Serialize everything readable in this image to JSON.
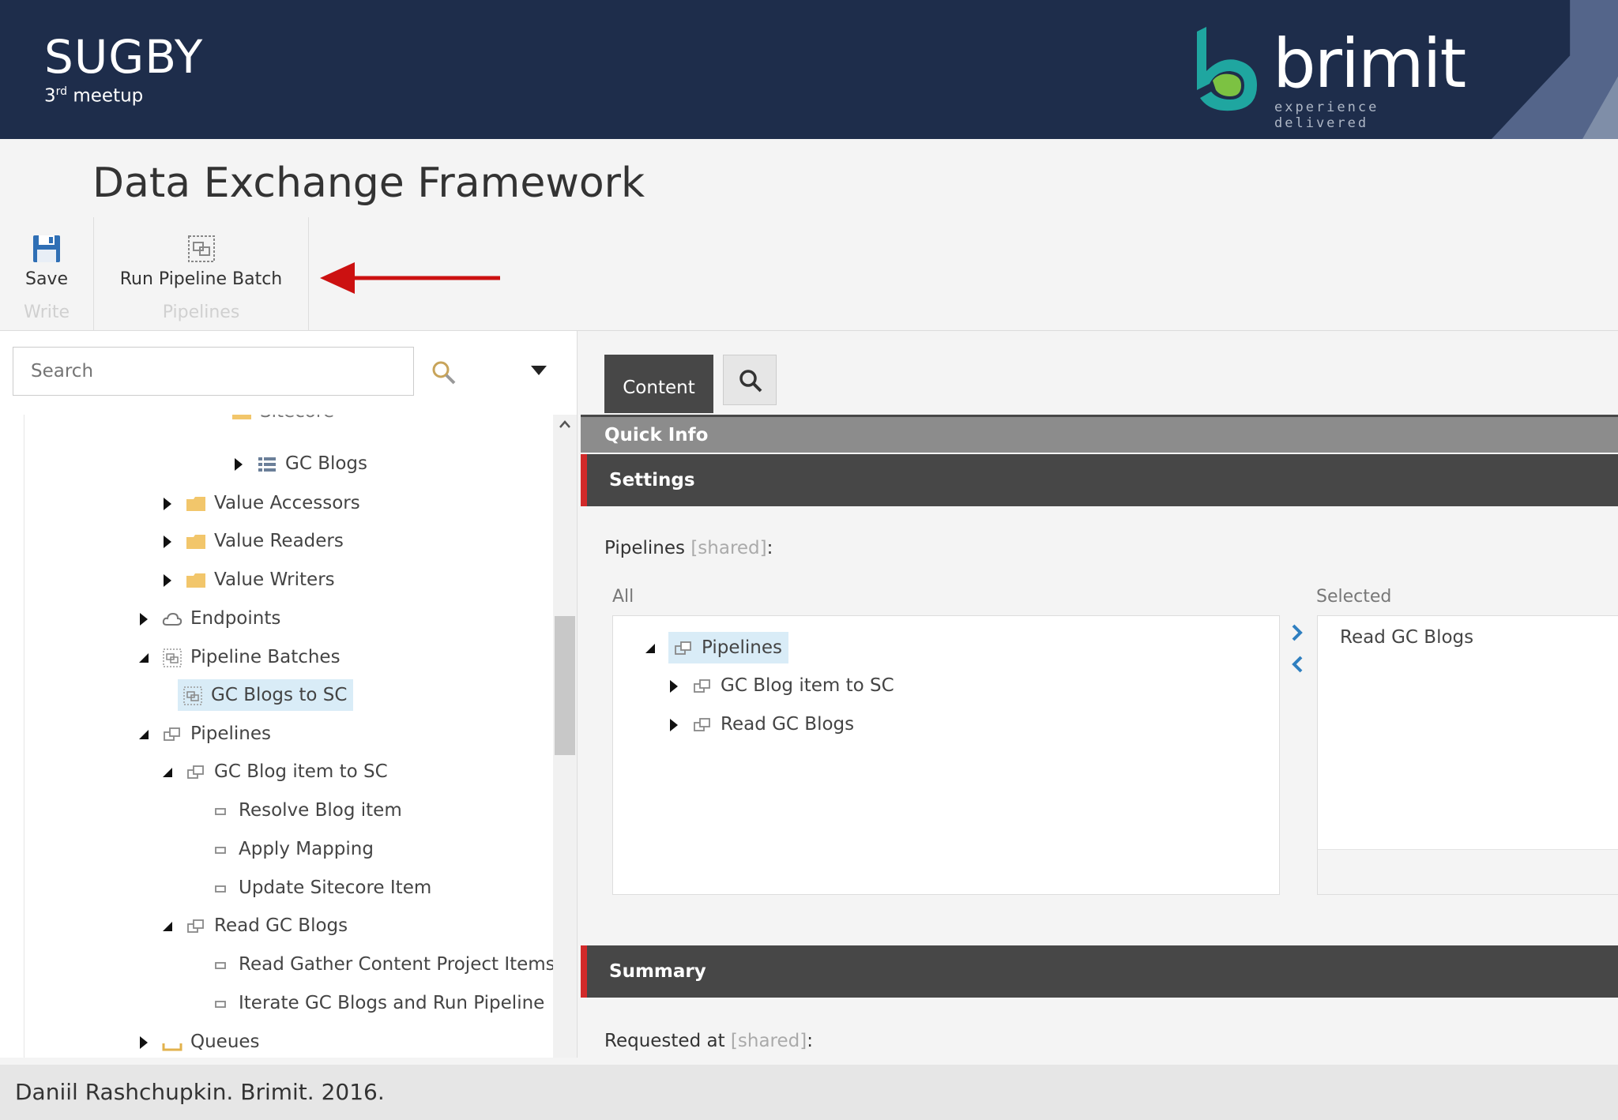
{
  "header": {
    "title": "SUGBY",
    "subtitle_number": "3",
    "subtitle_suffix": "rd",
    "subtitle_text": " meetup",
    "logo_word": "brimit",
    "logo_tagline": "experience delivered"
  },
  "slide": {
    "heading": "Data Exchange Framework"
  },
  "ribbon": {
    "save_label": "Save",
    "write_group": "Write",
    "run_label": "Run Pipeline Batch",
    "pipelines_group": "Pipelines"
  },
  "search": {
    "placeholder": "Search"
  },
  "tree": {
    "partial_top": "Sitecore",
    "gc_blogs": "GC Blogs",
    "value_accessors": "Value Accessors",
    "value_readers": "Value Readers",
    "value_writers": "Value Writers",
    "endpoints": "Endpoints",
    "pipeline_batches": "Pipeline Batches",
    "gc_blogs_to_sc": "GC Blogs to SC",
    "pipelines": "Pipelines",
    "gc_blog_item_to_sc": "GC Blog item to SC",
    "resolve_blog_item": "Resolve Blog item",
    "apply_mapping": "Apply Mapping",
    "update_sitecore_item": "Update Sitecore Item",
    "read_gc_blogs": "Read GC Blogs",
    "read_gather_content": "Read Gather Content Project Items Pip",
    "iterate_gc_blogs": "Iterate GC Blogs and Run Pipeline",
    "queues": "Queues"
  },
  "content": {
    "tab_label": "Content",
    "quick_info": "Quick Info",
    "settings": "Settings",
    "pipelines_field": "Pipelines",
    "shared_tag": "[shared]",
    "colon": ":",
    "all_label": "All",
    "selected_label": "Selected",
    "all_tree": {
      "root": "Pipelines",
      "child1": "GC Blog item to SC",
      "child2": "Read GC Blogs"
    },
    "selected_items": [
      "Read GC Blogs"
    ],
    "summary": "Summary",
    "requested_at_field": "Requested at"
  },
  "footer": {
    "text": "Daniil Rashchupkin. Brimit. 2016."
  },
  "colors": {
    "header_bg": "#1e2d4b",
    "accent_red": "#d12a2a",
    "section_bg": "#474747",
    "selection_bg": "#d9ecf7",
    "logo_teal": "#1fa6a0",
    "logo_green": "#7cc242"
  },
  "icons": {
    "save": "floppy-disk-icon",
    "run_batch": "pipeline-batch-icon",
    "search": "magnifier-icon",
    "folder": "folder-icon",
    "cloud": "cloud-icon",
    "pipeline": "pipeline-icon",
    "step": "pipeline-step-icon"
  }
}
